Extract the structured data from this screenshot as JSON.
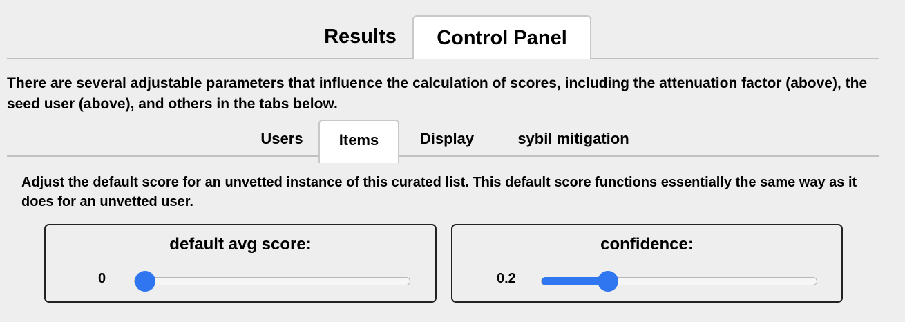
{
  "main_tabs": {
    "results": "Results",
    "control_panel": "Control Panel",
    "active": "Control Panel"
  },
  "intro": "There are several adjustable parameters that influence the calculation of scores, including the attenuation factor (above), the seed user (above), and others in the tabs below.",
  "sub_tabs": {
    "users": "Users",
    "items": "Items",
    "display": "Display",
    "sybil": "sybil mitigation",
    "active": "Items"
  },
  "description": "Adjust the default score for an unvetted instance of this curated list. This default score functions essentially the same way as it does for an unvetted user.",
  "sliders": {
    "default_avg": {
      "label": "default avg score:",
      "value": "0",
      "fraction": 0.0
    },
    "confidence": {
      "label": "confidence:",
      "value": "0.2",
      "fraction": 0.22
    }
  },
  "colors": {
    "accent": "#2f76f0",
    "background": "#eeeeee"
  }
}
